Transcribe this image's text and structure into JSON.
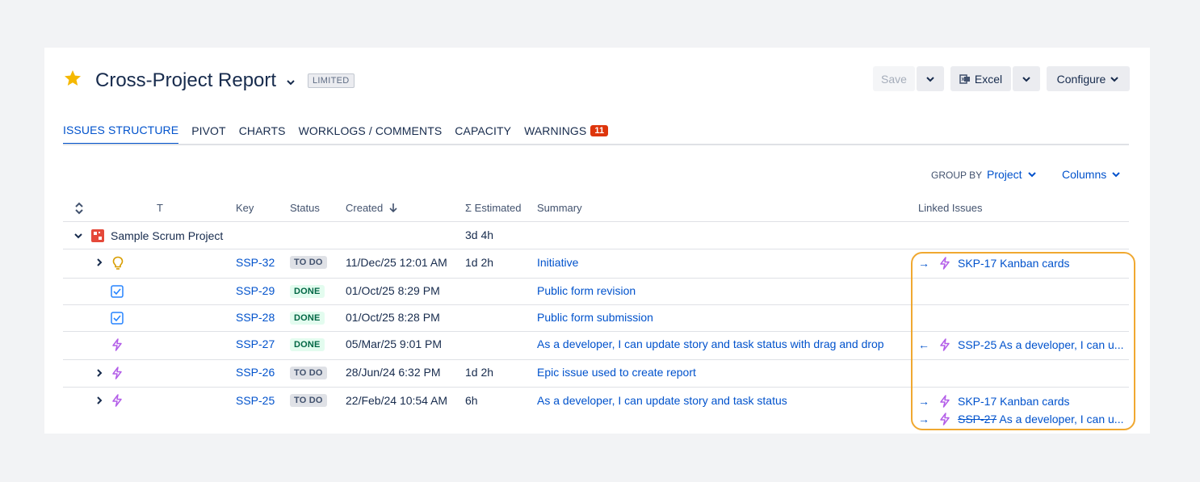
{
  "header": {
    "title": "Cross-Project Report",
    "badge": "LIMITED",
    "save_label": "Save",
    "excel_label": "Excel",
    "configure_label": "Configure"
  },
  "tabs": [
    {
      "label": "ISSUES STRUCTURE",
      "active": true
    },
    {
      "label": "PIVOT"
    },
    {
      "label": "CHARTS"
    },
    {
      "label": "WORKLOGS / COMMENTS"
    },
    {
      "label": "CAPACITY"
    },
    {
      "label": "WARNINGS",
      "badge": "11"
    }
  ],
  "toolbar": {
    "group_by_label": "GROUP BY",
    "group_by_value": "Project",
    "columns_label": "Columns"
  },
  "columns": {
    "t": "T",
    "key": "Key",
    "status": "Status",
    "created": "Created",
    "estimated": "Σ Estimated",
    "summary": "Summary",
    "linked": "Linked Issues"
  },
  "group": {
    "name": "Sample Scrum Project",
    "estimated": "3d 4h"
  },
  "rows": [
    {
      "key": "SSP-32",
      "status": "TO DO",
      "created": "11/Dec/25 12:01 AM",
      "estimated": "1d 2h",
      "summary": "Initiative",
      "links": [
        {
          "direction": "→",
          "key": "SKP-17",
          "text": "Kanban cards"
        }
      ]
    },
    {
      "key": "SSP-29",
      "status": "DONE",
      "created": "01/Oct/25 8:29 PM",
      "estimated": "",
      "summary": "Public form revision",
      "links": []
    },
    {
      "key": "SSP-28",
      "status": "DONE",
      "created": "01/Oct/25 8:28 PM",
      "estimated": "",
      "summary": "Public form submission",
      "links": []
    },
    {
      "key": "SSP-27",
      "status": "DONE",
      "created": "05/Mar/25 9:01 PM",
      "estimated": "",
      "summary": "As a developer, I can update story and task status with drag and drop",
      "links": [
        {
          "direction": "←",
          "key": "SSP-25",
          "text": "As a developer, I can u..."
        }
      ]
    },
    {
      "key": "SSP-26",
      "status": "TO DO",
      "created": "28/Jun/24 6:32 PM",
      "estimated": "1d 2h",
      "summary": "Epic issue used to create report",
      "links": []
    },
    {
      "key": "SSP-25",
      "status": "TO DO",
      "created": "22/Feb/24 10:54 AM",
      "estimated": "6h",
      "summary": "As a developer, I can update story and task status",
      "links": [
        {
          "direction": "→",
          "key": "SKP-17",
          "text": "Kanban cards"
        },
        {
          "direction": "→",
          "key": "SSP-27",
          "text": "As a developer, I can u...",
          "struck": true
        }
      ]
    }
  ],
  "colors": {
    "accent": "#0052cc",
    "warning": "#de350b",
    "highlight": "#f0a830",
    "star": "#f5b800",
    "epic": "#b35ee8"
  }
}
